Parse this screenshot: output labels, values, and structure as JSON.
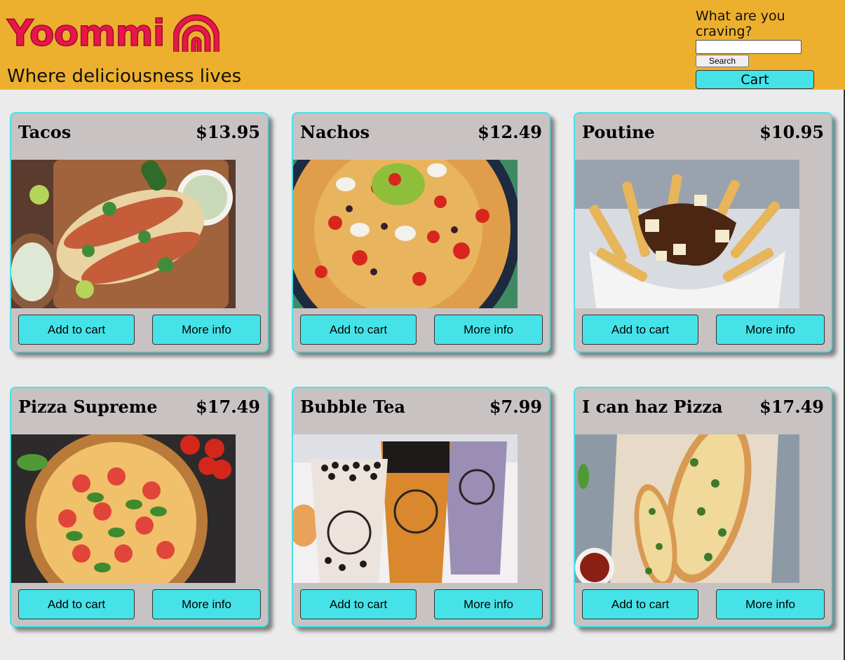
{
  "header": {
    "brand": "Yoommi",
    "tagline": "Where deliciousness lives",
    "search_prompt": "What are you craving?",
    "search_value": "",
    "search_button": "Search",
    "cart_button": "Cart",
    "brand_color": "#e8164a",
    "header_color": "#edb02e"
  },
  "products": [
    {
      "name": "Tacos",
      "price": "$13.95",
      "image": "tacos-image",
      "add_label": "Add to cart",
      "info_label": "More info"
    },
    {
      "name": "Nachos",
      "price": "$12.49",
      "image": "nachos-image",
      "add_label": "Add to cart",
      "info_label": "More info"
    },
    {
      "name": "Poutine",
      "price": "$10.95",
      "image": "poutine-image",
      "add_label": "Add to cart",
      "info_label": "More info"
    },
    {
      "name": "Pizza Supreme",
      "price": "$17.49",
      "image": "pizza-image",
      "add_label": "Add to cart",
      "info_label": "More info"
    },
    {
      "name": "Bubble Tea",
      "price": "$7.99",
      "image": "bubble-tea-image",
      "add_label": "Add to cart",
      "info_label": "More info"
    },
    {
      "name": "I can haz Pizza",
      "price": "$17.49",
      "image": "flatbread-pizza-image",
      "add_label": "Add to cart",
      "info_label": "More info"
    }
  ],
  "accent_color": "#45e3e8",
  "card_color": "#c8c3c2"
}
